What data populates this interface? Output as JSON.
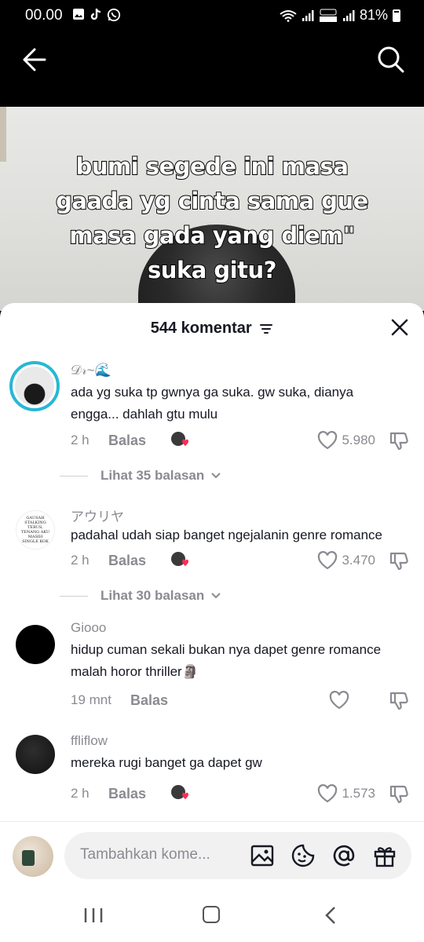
{
  "status_bar": {
    "time": "00.00",
    "battery": "81%"
  },
  "video": {
    "caption_lines": [
      "bumi segede ini masa",
      "gaada yg cinta sama gue",
      "masa gada yang diem\"",
      "suka gitu?"
    ]
  },
  "comments_sheet": {
    "count_label": "544 komentar",
    "comments": [
      {
        "user": "𝒟𝓇~🌊",
        "text": "ada yg suka tp gwnya ga suka. gw suka, dianya engga... dahlah gtu mulu",
        "time": "2 h",
        "reply": "Balas",
        "likes": "5.980",
        "replies_label": "Lihat 35 balasan",
        "creator_liked": true
      },
      {
        "user": "アウリヤ",
        "text": "padahal udah siap banget ngejalanin genre romance",
        "time": "2 h",
        "reply": "Balas",
        "likes": "3.470",
        "replies_label": "Lihat 30 balasan",
        "creator_liked": true,
        "avatar_text": "GAUSAH STALKING TERUS, TENANG AKU MASIH SINGLE KOK"
      },
      {
        "user": "Giooo",
        "text": "hidup cuman sekali bukan nya dapet genre romance malah horor thriller🗿",
        "time": "19 mnt",
        "reply": "Balas",
        "likes": "",
        "creator_liked": false
      },
      {
        "user": "ffliflow",
        "text": "mereka rugi banget ga dapet gw",
        "time": "2 h",
        "reply": "Balas",
        "likes": "1.573",
        "creator_liked": true
      }
    ]
  },
  "input": {
    "placeholder": "Tambahkan kome..."
  },
  "colors": {
    "like_heart": "#fe2c55",
    "muted": "#8a8b91",
    "text": "#161823"
  }
}
